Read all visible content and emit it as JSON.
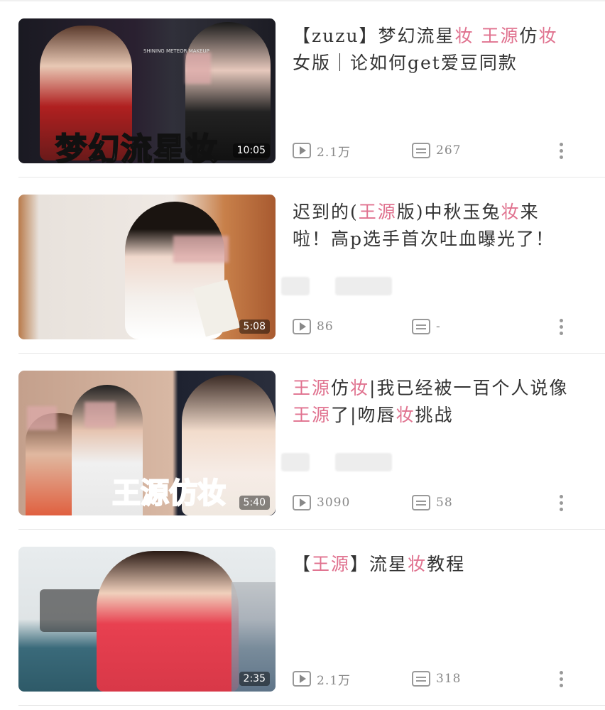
{
  "videos": [
    {
      "title_parts": [
        {
          "t": "【zuzu】梦幻流星",
          "hl": false
        },
        {
          "t": "妆",
          "hl": true
        },
        {
          "t": " ",
          "hl": false
        },
        {
          "t": "王源",
          "hl": true
        },
        {
          "t": "仿",
          "hl": false
        },
        {
          "t": "妆",
          "hl": true
        },
        {
          "t": "女版｜论如何get爱豆同款",
          "hl": false
        }
      ],
      "thumb_caption": "梦幻流星妆",
      "thumb_small_text": "SHINING METEOR MAKEUP",
      "duration": "10:05",
      "plays": "2.1万",
      "comments": "267"
    },
    {
      "title_parts": [
        {
          "t": "迟到的(",
          "hl": false
        },
        {
          "t": "王源",
          "hl": true
        },
        {
          "t": "版)中秋玉兔",
          "hl": false
        },
        {
          "t": "妆",
          "hl": true
        },
        {
          "t": "来啦！高p选手首次吐血曝光了！",
          "hl": false
        }
      ],
      "thumb_caption": "",
      "duration": "5:08",
      "plays": "86",
      "comments": "-"
    },
    {
      "title_parts": [
        {
          "t": "王源",
          "hl": true
        },
        {
          "t": "仿",
          "hl": false
        },
        {
          "t": "妆",
          "hl": true
        },
        {
          "t": "|我已经被一百个人说像",
          "hl": false
        },
        {
          "t": "王源",
          "hl": true
        },
        {
          "t": "了|吻唇",
          "hl": false
        },
        {
          "t": "妆",
          "hl": true
        },
        {
          "t": "挑战",
          "hl": false
        }
      ],
      "thumb_caption": "王源仿妆",
      "duration": "5:40",
      "plays": "3090",
      "comments": "58"
    },
    {
      "title_parts": [
        {
          "t": "【",
          "hl": false
        },
        {
          "t": "王源",
          "hl": true
        },
        {
          "t": "】流星",
          "hl": false
        },
        {
          "t": "妆",
          "hl": true
        },
        {
          "t": "教程",
          "hl": false
        }
      ],
      "thumb_caption": "",
      "duration": "2:35",
      "plays": "2.1万",
      "comments": "318"
    }
  ],
  "icons": {
    "play": "play-count-icon",
    "comment": "comment-list-icon",
    "more": "more-vertical-icon"
  },
  "colors": {
    "highlight": "#e0728f",
    "text": "#333333",
    "meta": "#888888"
  }
}
